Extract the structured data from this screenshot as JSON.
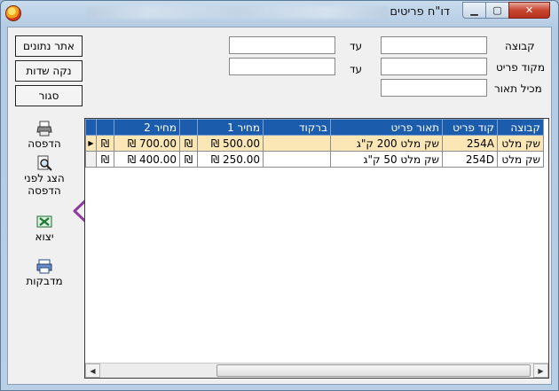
{
  "window": {
    "title": "דו\"ח פריטים",
    "controls": {
      "minimize": "▁",
      "maximize": "▢",
      "close": "✕"
    },
    "accent_color": "#1c5cad"
  },
  "filters": {
    "group_label": "קבוצה",
    "item_code_label": "מקוד פריט",
    "description_label": "מכיל תאור",
    "to_label": "עד",
    "group_from": "",
    "group_to": "",
    "item_code_from": "",
    "item_code_to": "",
    "description_contains": ""
  },
  "buttons": {
    "find": "אתר נתונים",
    "clear": "נקה שדות",
    "close": "סגור"
  },
  "tools": [
    {
      "label": "הדפסה",
      "icon": "printer-icon"
    },
    {
      "label": "הצג לפני הדפסה",
      "icon": "print-preview-icon"
    },
    {
      "label": "יצוא",
      "icon": "excel-export-icon"
    },
    {
      "label": "מדבקות",
      "icon": "label-printer-icon"
    }
  ],
  "table": {
    "columns": [
      "קבוצה",
      "קוד פריט",
      "תאור פריט",
      "ברקוד",
      "מחיר 1",
      "מחיר 2"
    ],
    "rows": [
      {
        "group": "שק מלט",
        "code": "254A",
        "description": "שק מלט 200 ק\"ג",
        "barcode": "",
        "price1": "500.00 ₪",
        "cur1": "₪",
        "price2": "700.00 ₪",
        "cur2": "₪"
      },
      {
        "group": "שק מלט",
        "code": "254D",
        "description": "שק מלט 50 ק\"ג",
        "barcode": "",
        "price1": "250.00 ₪",
        "cur1": "₪",
        "price2": "400.00 ₪",
        "cur2": "₪"
      }
    ],
    "selected_row": 0
  },
  "scrollbar": {
    "left": "◀",
    "right": "▶"
  }
}
